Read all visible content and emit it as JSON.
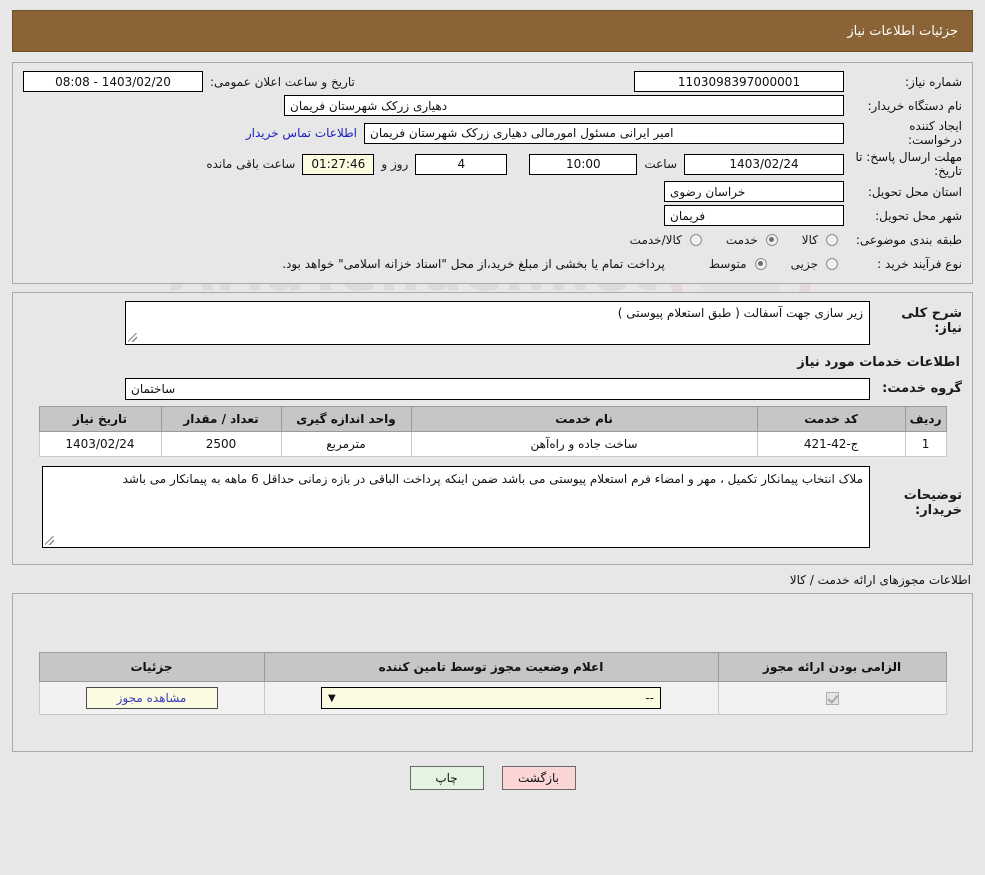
{
  "header": {
    "title": "جزئیات اطلاعات نیاز"
  },
  "info": {
    "need_number_label": "شماره نیاز:",
    "need_number_value": "1103098397000001",
    "announce_label": "تاریخ و ساعت اعلان عمومی:",
    "announce_value": "1403/02/20 - 08:08",
    "buyer_org_label": "نام دستگاه خریدار:",
    "buyer_org_value": "دهیاری زرکک شهرستان فریمان",
    "creator_label": "ایجاد کننده درخواست:",
    "creator_value": "امیر ایرانی مسئول امورمالی دهیاری زرکک شهرستان فریمان",
    "contact_link": "اطلاعات تماس خریدار",
    "deadline_label": "مهلت ارسال پاسخ: تا تاریخ:",
    "deadline_date": "1403/02/24",
    "time_label": "ساعت",
    "deadline_time": "10:00",
    "days_value": "4",
    "days_label": "روز و",
    "countdown_value": "01:27:46",
    "countdown_label": "ساعت باقی مانده",
    "province_label": "استان محل تحویل:",
    "province_value": "خراسان رضوی",
    "city_label": "شهر محل تحویل:",
    "city_value": "فریمان",
    "category_label": "طبقه بندی موضوعی:",
    "category_options": [
      {
        "label": "کالا",
        "selected": false
      },
      {
        "label": "خدمت",
        "selected": true
      },
      {
        "label": "کالا/خدمت",
        "selected": false
      }
    ],
    "process_label": "نوع فرآیند خرید :",
    "process_options": [
      {
        "label": "جزیی",
        "selected": false
      },
      {
        "label": "متوسط",
        "selected": true
      }
    ],
    "process_note": "پرداخت تمام یا بخشی از مبلغ خرید،از محل \"اسناد خزانه اسلامی\" خواهد بود."
  },
  "details": {
    "general_desc_label": "شرح کلی نیاز:",
    "general_desc_value": "زیر سازی جهت آسفالت ( طبق استعلام پیوستی )",
    "services_section_title": "اطلاعات خدمات مورد نیاز",
    "service_group_label": "گروه خدمت:",
    "service_group_value": "ساختمان",
    "buyer_notes_label": "توضیحات خریدار:",
    "buyer_notes_value": "ملاک انتخاب پیمانکار تکمیل ، مهر و امضاء فرم استعلام پیوستی می باشد ضمن اینکه پرداخت الباقی در بازه زمانی حداقل 6 ماهه به پیمانکار می باشد"
  },
  "services_table": {
    "columns": [
      "ردیف",
      "کد خدمت",
      "نام خدمت",
      "واحد اندازه گیری",
      "تعداد / مقدار",
      "تاریخ نیاز"
    ],
    "rows": [
      {
        "row_no": "1",
        "service_code": "ج-42-421",
        "service_name": "ساخت جاده و راه‌آهن",
        "unit": "مترمربع",
        "quantity": "2500",
        "need_date": "1403/02/24"
      }
    ]
  },
  "permits": {
    "section_label": "اطلاعات مجوزهای ارائه خدمت / کالا",
    "columns": [
      "الزامی بودن ارائه مجوز",
      "اعلام وضعیت مجوز توسط تامین کننده",
      "جزئیات"
    ],
    "rows": [
      {
        "required_checked": true,
        "status_value": "--",
        "details_button": "مشاهده مجوز"
      }
    ]
  },
  "footer": {
    "print_label": "چاپ",
    "back_label": "بازگشت"
  },
  "colors": {
    "header_bar": "#8a6437",
    "page_bg": "#e7e7e7",
    "table_header": "#c6c6c6",
    "link": "#2020c0",
    "highlight_field": "#fbfbe2",
    "back_button": "#fbd5d5",
    "print_button": "#e3f5e0"
  }
}
